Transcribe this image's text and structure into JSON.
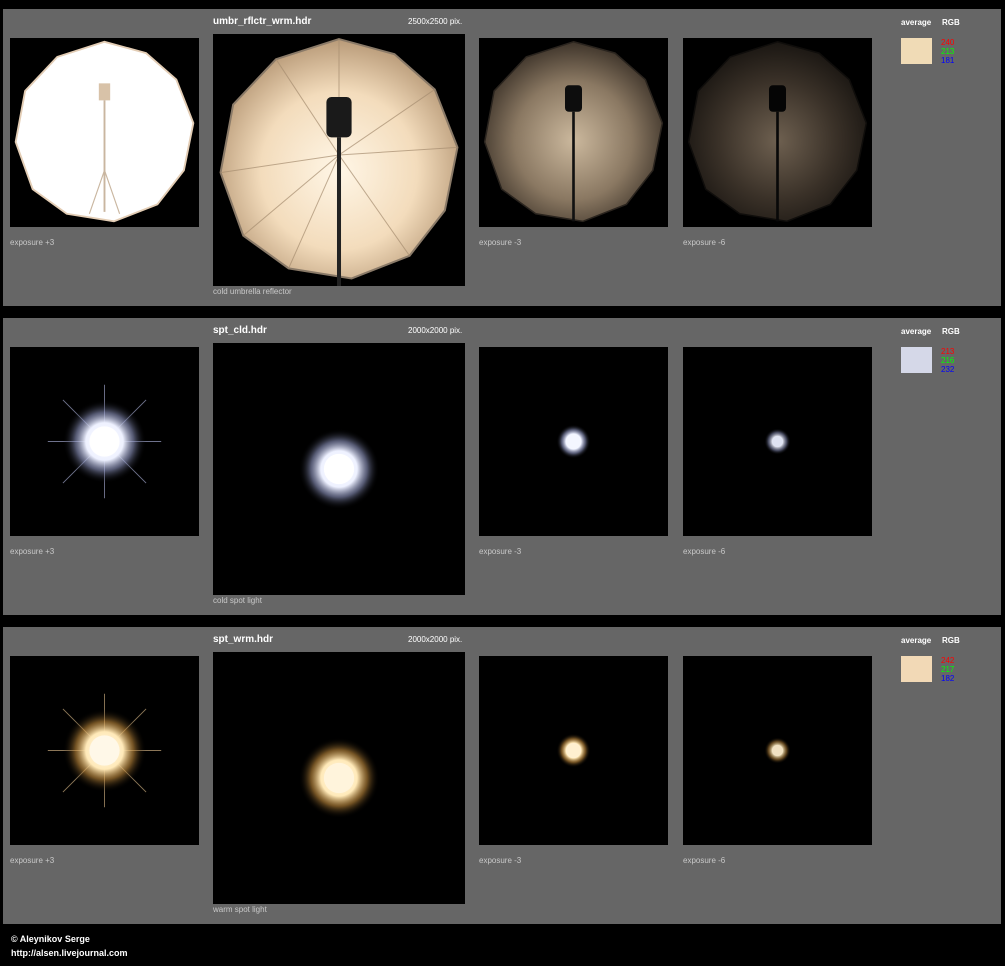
{
  "panels": [
    {
      "title": "umbr_rflctr_wrm.hdr",
      "resolution": "2500x2500 pix.",
      "average_label": "average",
      "rgb_label": "RGB",
      "swatch_color": "#f0dbb6",
      "rgb": {
        "r": "240",
        "g": "213",
        "b": "181"
      },
      "captions": [
        "exposure +3",
        "cold umbrella reflector",
        "exposure -3",
        "exposure -6"
      ]
    },
    {
      "title": "spt_cld.hdr",
      "resolution": "2000x2000 pix.",
      "average_label": "average",
      "rgb_label": "RGB",
      "swatch_color": "#d5d8e8",
      "rgb": {
        "r": "213",
        "g": "216",
        "b": "232"
      },
      "captions": [
        "exposure +3",
        "cold spot light",
        "exposure -3",
        "exposure -6"
      ]
    },
    {
      "title": "spt_wrm.hdr",
      "resolution": "2000x2000 pix.",
      "average_label": "average",
      "rgb_label": "RGB",
      "swatch_color": "#f2d9b6",
      "rgb": {
        "r": "242",
        "g": "217",
        "b": "182"
      },
      "captions": [
        "exposure +3",
        "warm spot light",
        "exposure -3",
        "exposure -6"
      ]
    }
  ],
  "footer": {
    "copyright": "© Aleynikov Serge",
    "url": "http://alsen.livejournal.com"
  }
}
